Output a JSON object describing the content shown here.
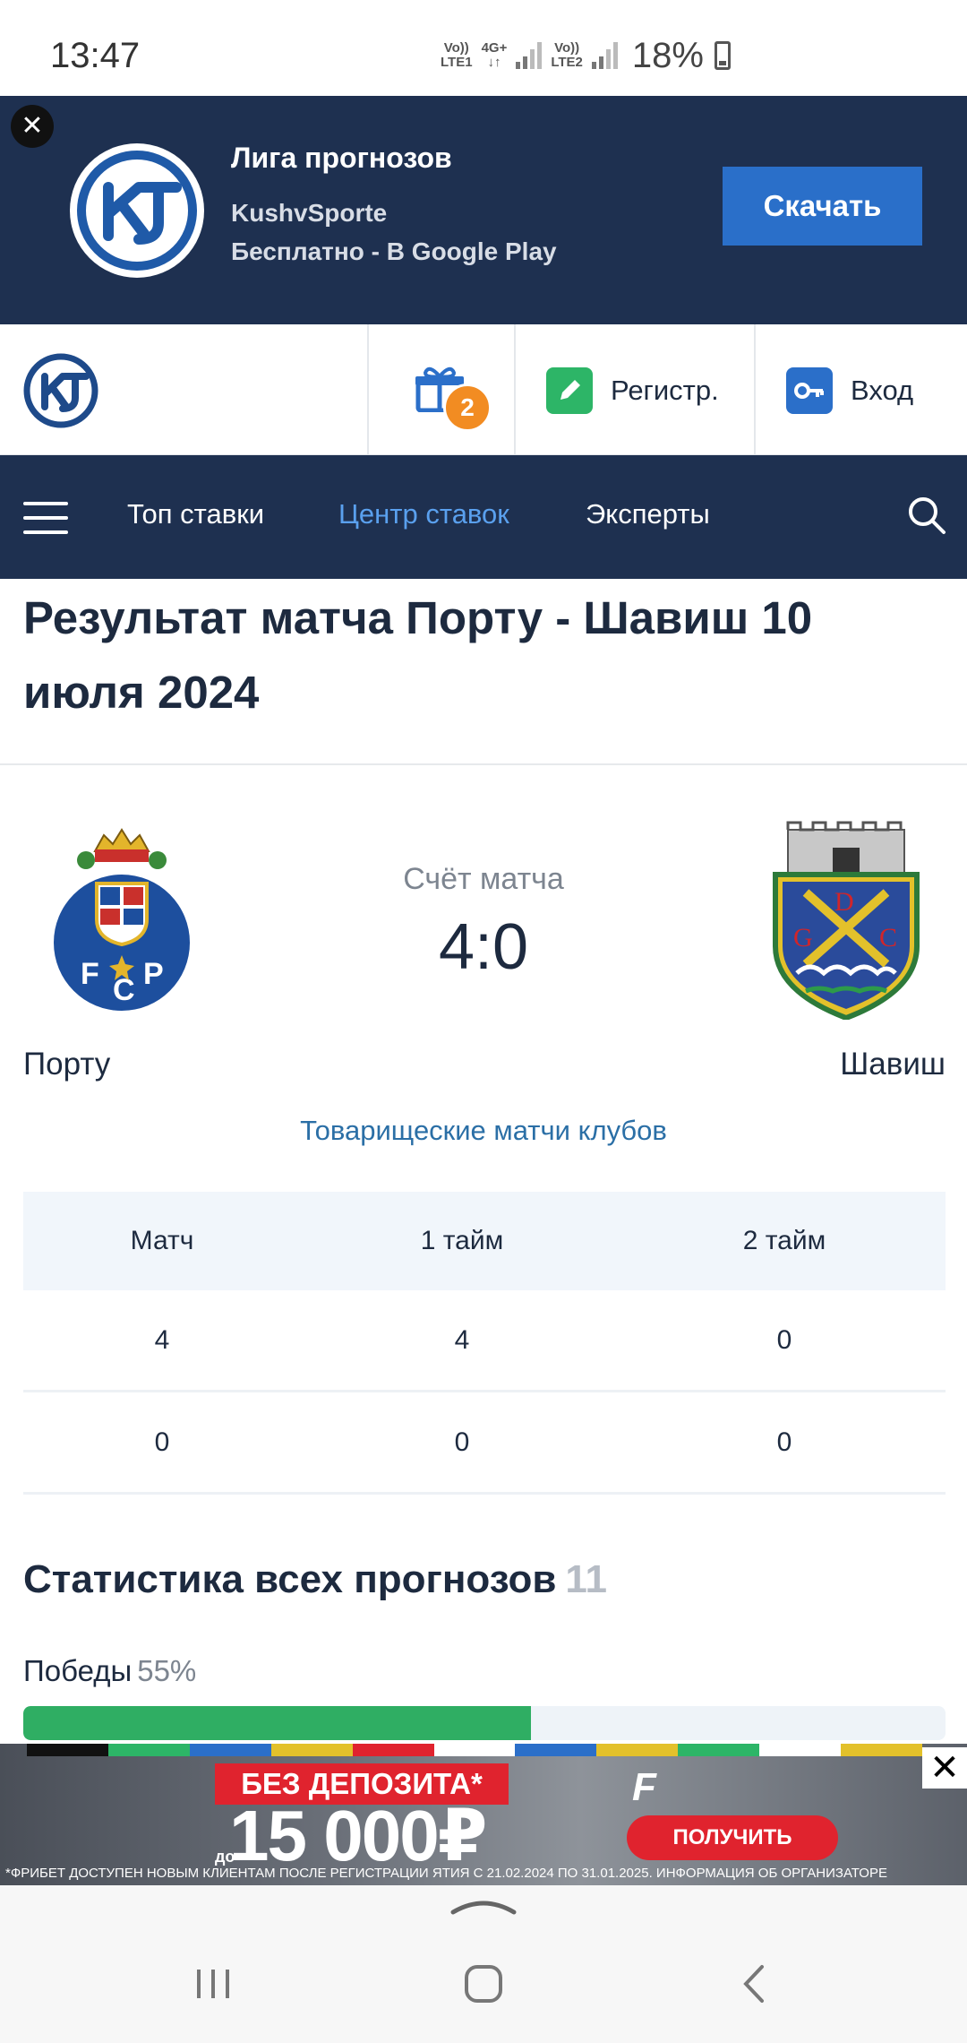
{
  "status_bar": {
    "time": "13:47",
    "net1_top": "Vo))",
    "net1_bottom": "LTE1",
    "net_mid_top": "4G+",
    "net_mid_bottom": "↓↑",
    "net2_top": "Vo))",
    "net2_bottom": "LTE2",
    "battery": "18%"
  },
  "app_banner": {
    "close": "✕",
    "title": "Лига прогнозов",
    "developer": "KushvSporte",
    "subtitle": "Бесплатно - В Google Play",
    "button": "Скачать"
  },
  "header": {
    "gift_count": "2",
    "register": "Регистр.",
    "login": "Вход"
  },
  "nav": {
    "items": [
      "Топ ставки",
      "Центр ставок",
      "Эксперты"
    ],
    "active_index": 1
  },
  "page": {
    "title": "Результат матча Порту - Шавиш 10 июля 2024"
  },
  "match": {
    "score_label": "Счёт матча",
    "score": "4:0",
    "home_team": "Порту",
    "away_team": "Шавиш",
    "tournament": "Товарищеские матчи клубов"
  },
  "score_table": {
    "headers": [
      "Матч",
      "1 тайм",
      "2 тайм"
    ],
    "rows": [
      [
        "4",
        "4",
        "0"
      ],
      [
        "0",
        "0",
        "0"
      ]
    ]
  },
  "stats": {
    "title": "Статистика всех прогнозов",
    "count": "11",
    "wins_label": "Победы",
    "wins_pct": "55%",
    "wins_fraction": 0.55
  },
  "ad": {
    "badge": "БЕЗ ДЕПОЗИТА*",
    "prefix": "до",
    "amount": "15 000₽",
    "brand": "F",
    "button": "ПОЛУЧИТЬ",
    "fine_print": "*ФРИБЕТ ДОСТУПЕН НОВЫМ КЛИЕНТАМ ПОСЛЕ РЕГИСТРАЦИИ   ЯТИЯ С 21.02.2024 ПО 31.01.2025. ИНФОРМАЦИЯ ОБ ОРГАНИЗАТОРЕ",
    "close": "✕"
  },
  "colors": {
    "navy": "#1e3050",
    "accent_blue": "#2a6fc9",
    "active_nav": "#5aa0ee",
    "win_green": "#2fae63",
    "badge_orange": "#f28c22",
    "ad_red": "#e0232e"
  }
}
